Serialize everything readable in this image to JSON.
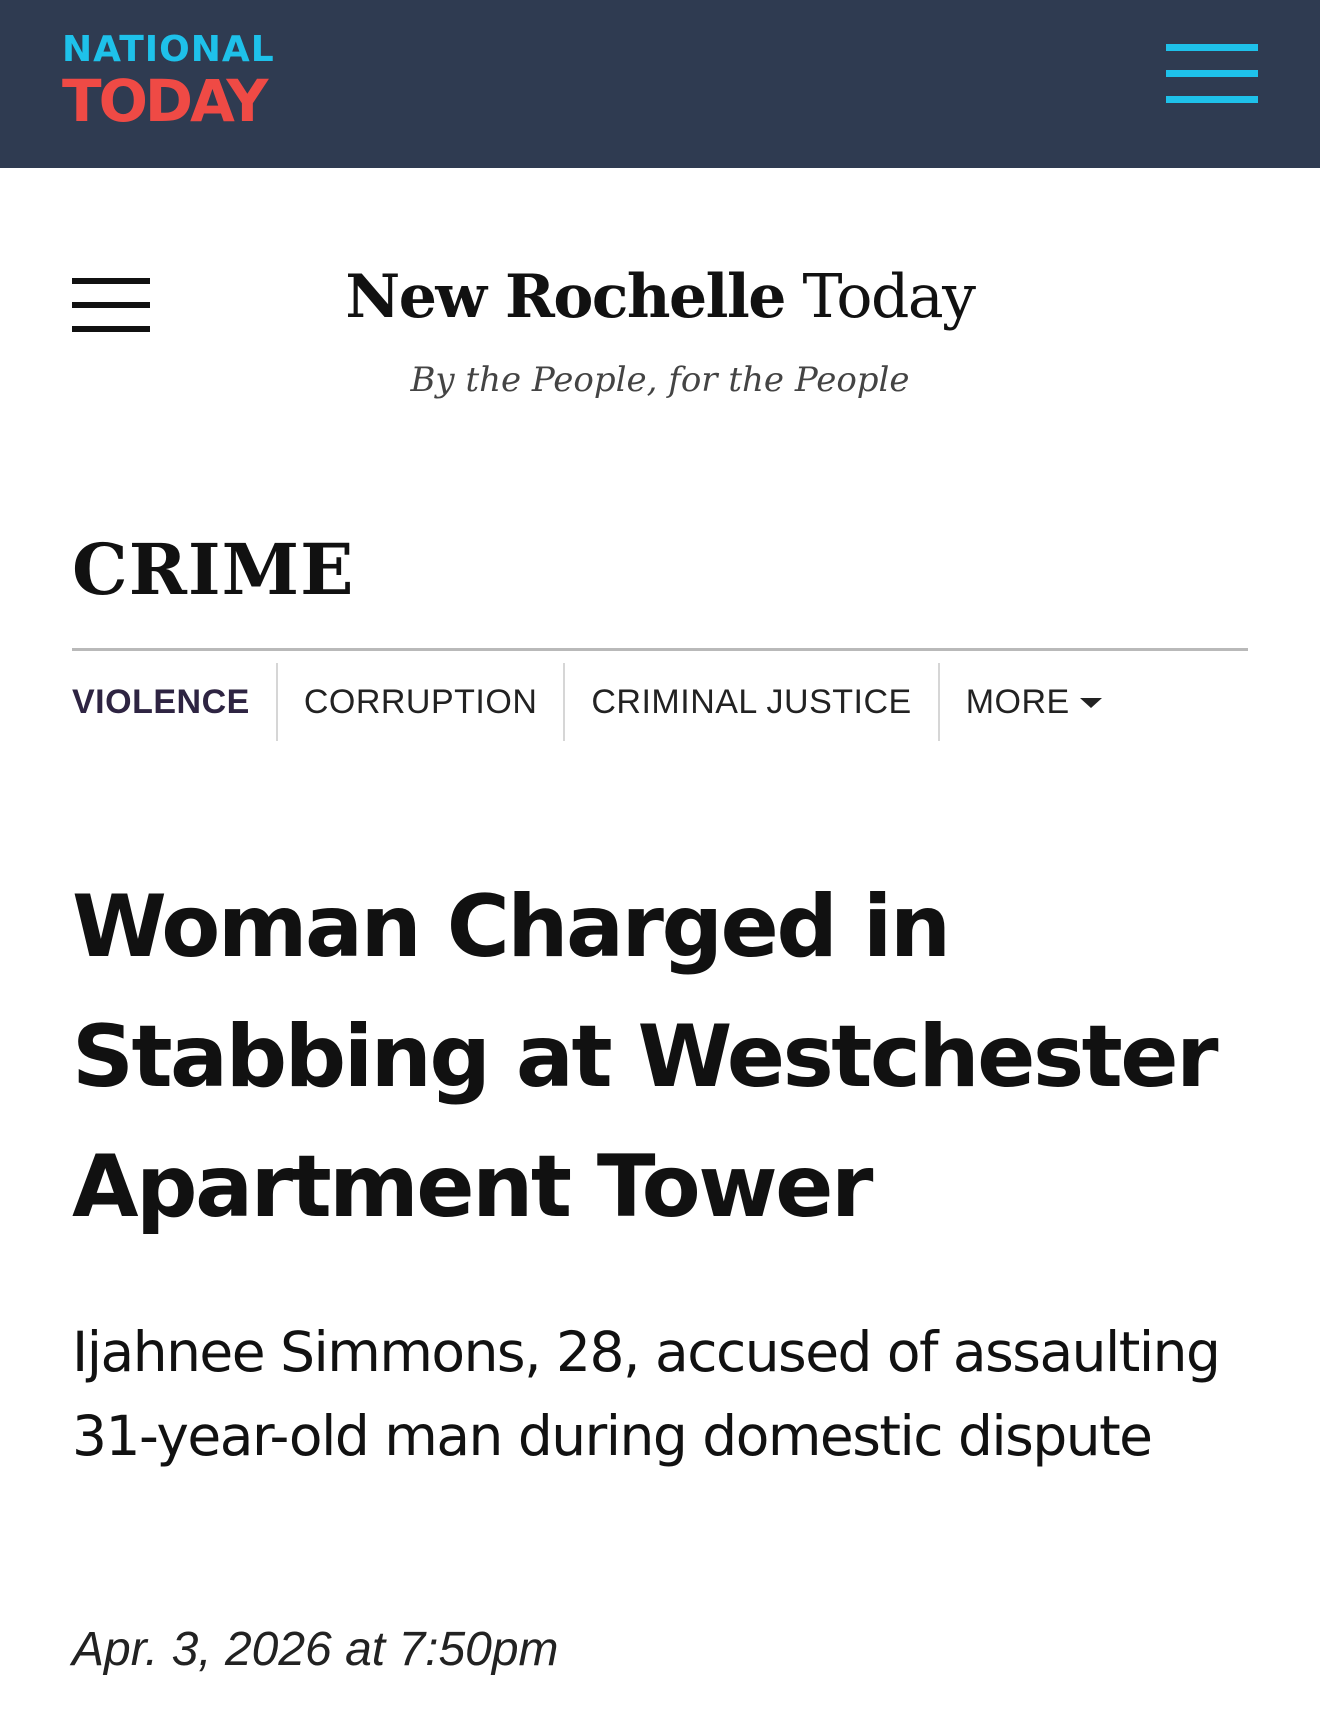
{
  "national_today": {
    "logo_line1": "NATIONAL",
    "logo_line2": "TODAY",
    "menu_icon": "hamburger-menu-icon",
    "bar_color": "#2f3b51",
    "accent_blue": "#1ec1ea",
    "accent_red": "#ef4a45"
  },
  "site": {
    "menu_icon": "hamburger-menu-icon",
    "title_bold": "New Rochelle",
    "title_light": "Today",
    "tagline": "By the People, for the People"
  },
  "section": {
    "heading": "CRIME",
    "tabs": [
      {
        "label": "VIOLENCE",
        "active": true
      },
      {
        "label": "CORRUPTION",
        "active": false
      },
      {
        "label": "CRIMINAL JUSTICE",
        "active": false
      },
      {
        "label": "MORE",
        "active": false,
        "icon": "caret-down-icon"
      }
    ]
  },
  "article": {
    "headline": "Woman Charged in Stabbing at Westchester Apartment Tower",
    "subheadline": "Ijahnee Simmons, 28, accused of assaulting 31-year-old man during domestic dispute",
    "date": "Apr. 3, 2026 at 7:50pm"
  }
}
